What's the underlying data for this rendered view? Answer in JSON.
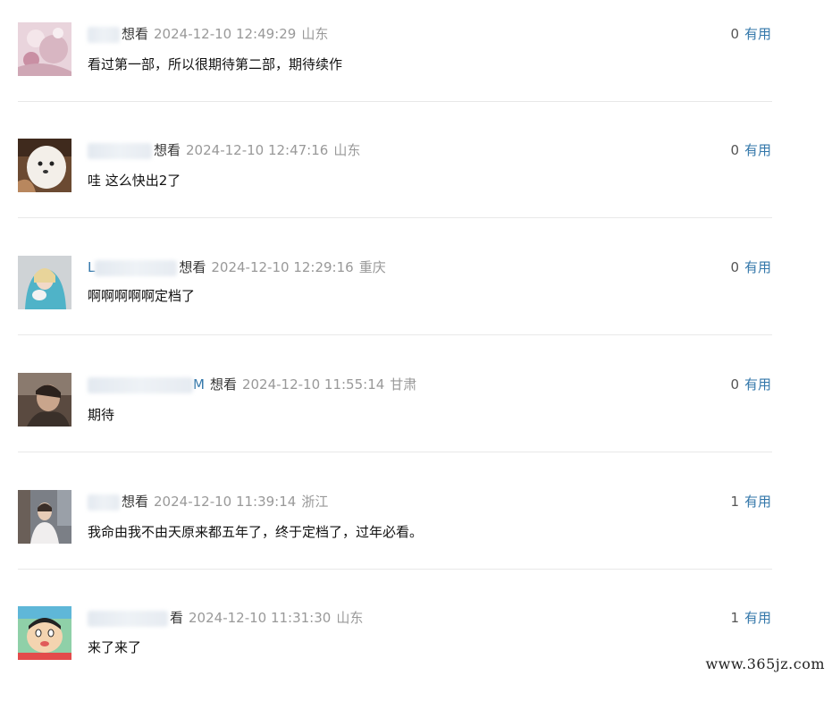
{
  "comments": [
    {
      "user_visible": "",
      "status": "想看",
      "time": "2024-12-10 12:49:29",
      "location": "山东",
      "votes": "0",
      "vote_label": "有用",
      "text": "看过第一部，所以很期待第二部，期待续作"
    },
    {
      "user_visible": "",
      "status": "想看",
      "time": "2024-12-10 12:47:16",
      "location": "山东",
      "votes": "0",
      "vote_label": "有用",
      "text": "哇 这么快出2了"
    },
    {
      "user_visible": "L",
      "status": "想看",
      "time": "2024-12-10 12:29:16",
      "location": "重庆",
      "votes": "0",
      "vote_label": "有用",
      "text": "啊啊啊啊啊定档了"
    },
    {
      "user_visible": "M",
      "status": "想看",
      "time": "2024-12-10 11:55:14",
      "location": "甘肃",
      "votes": "0",
      "vote_label": "有用",
      "text": "期待"
    },
    {
      "user_visible": "",
      "status": "想看",
      "time": "2024-12-10 11:39:14",
      "location": "浙江",
      "votes": "1",
      "vote_label": "有用",
      "text": "我命由我不由天原来都五年了，终于定档了，过年必看。"
    },
    {
      "user_visible": "",
      "status": "看",
      "time": "2024-12-10 11:31:30",
      "location": "山东",
      "votes": "1",
      "vote_label": "有用",
      "text": "来了来了"
    }
  ],
  "watermark": "www.365jz.com"
}
